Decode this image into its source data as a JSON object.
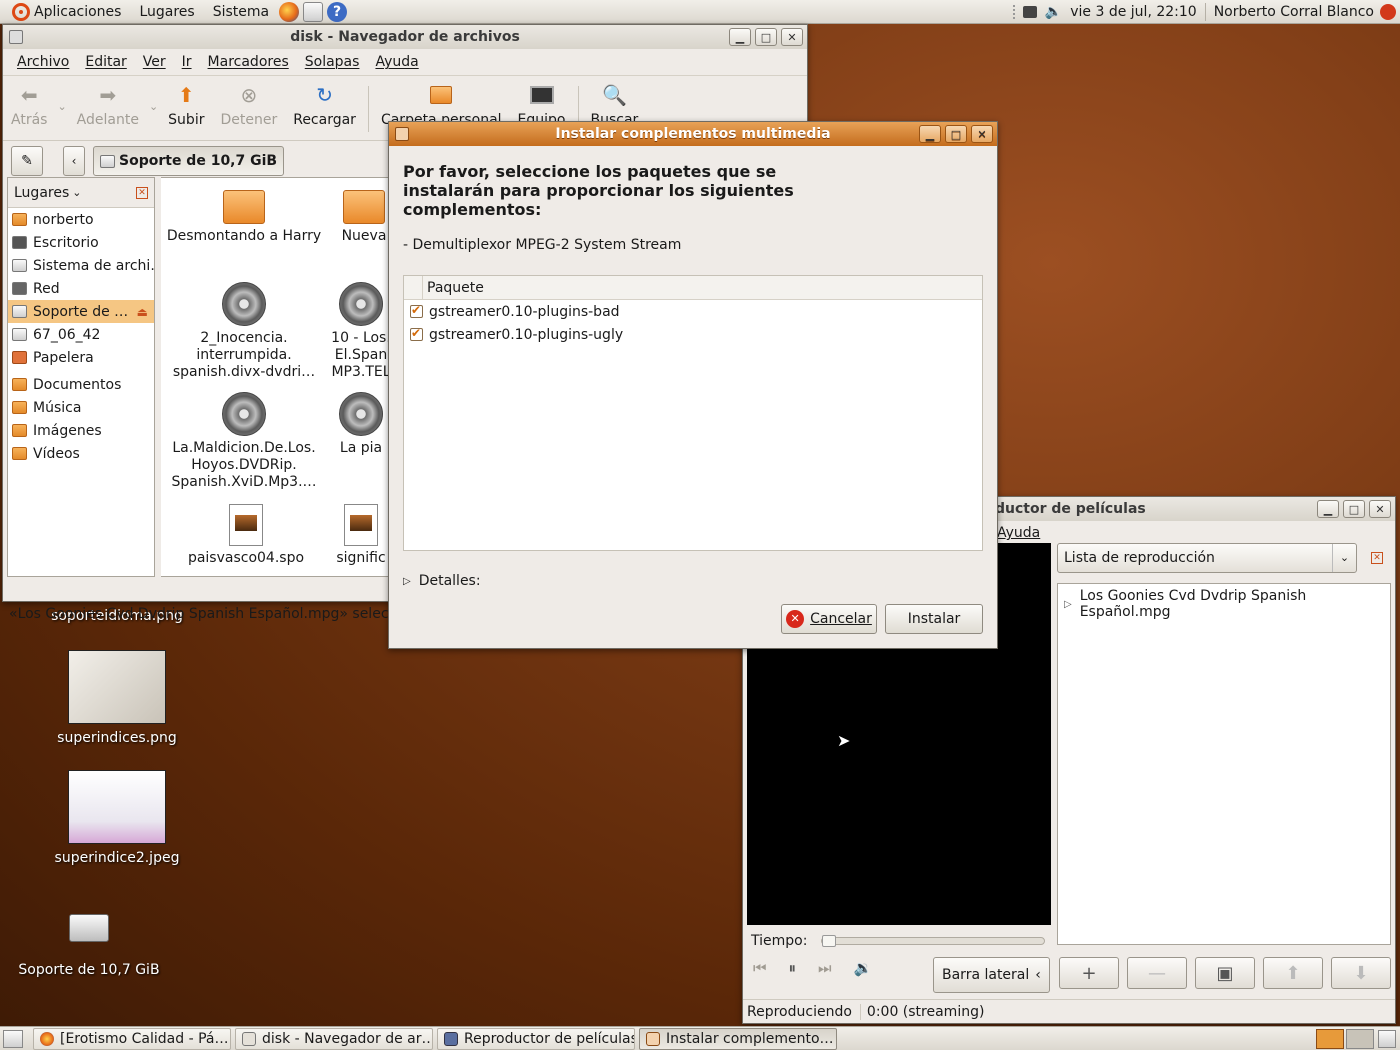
{
  "top_panel": {
    "menus": [
      "Aplicaciones",
      "Lugares",
      "Sistema"
    ],
    "clock": "vie  3 de jul, 22:10",
    "user": "Norberto Corral Blanco"
  },
  "file_manager": {
    "title": "disk - Navegador de archivos",
    "menu": [
      "Archivo",
      "Editar",
      "Ver",
      "Ir",
      "Marcadores",
      "Solapas",
      "Ayuda"
    ],
    "toolbar": {
      "back": "Atrás",
      "forward": "Adelante",
      "up": "Subir",
      "stop": "Detener",
      "reload": "Recargar",
      "home": "Carpeta personal",
      "computer": "Equipo",
      "search": "Buscar"
    },
    "location": "Soporte de 10,7 GiB",
    "sidebar_title": "Lugares",
    "places": [
      "norberto",
      "Escritorio",
      "Sistema de archi…",
      "Red",
      "Soporte de …",
      "67_06_42",
      "Papelera"
    ],
    "bookmarks": [
      "Documentos",
      "Música",
      "Imágenes",
      "Vídeos"
    ],
    "files": [
      {
        "name": "Desmontando a Harry",
        "kind": "folder"
      },
      {
        "name": "Nueva",
        "kind": "folder"
      },
      {
        "name": "2_Inocencia. interrumpida. spanish.divx-dvdri…",
        "kind": "video"
      },
      {
        "name": "10 - Los. El.Span MP3.TEL",
        "kind": "video"
      },
      {
        "name": "La.Maldicion.De.Los. Hoyos.DVDRip. Spanish.XviD.Mp3.…",
        "kind": "video"
      },
      {
        "name": "La pia",
        "kind": "video"
      },
      {
        "name": "paisvasco04.spo",
        "kind": "doc"
      },
      {
        "name": "signific",
        "kind": "doc"
      }
    ],
    "status": "«Los Goonies Cvd Dvdrip Spanish Español.mpg» selecciona"
  },
  "dialog": {
    "title": "Instalar complementos multimedia",
    "heading": "Por favor, seleccione los paquetes que se instalarán para proporcionar los siguientes complementos:",
    "plugin": "- Demultiplexor MPEG-2 System Stream",
    "column": "Paquete",
    "packages": [
      "gstreamer0.10-plugins-bad",
      "gstreamer0.10-plugins-ugly"
    ],
    "details": "Detalles:",
    "cancel": "Cancelar",
    "install": "Instalar"
  },
  "player": {
    "title": "ductor de películas",
    "menu": "Ayuda",
    "sidebar_combo": "Lista de reproducción",
    "playlist_item": "Los Goonies Cvd Dvdrip Spanish Español.mpg",
    "time_label": "Tiempo:",
    "sidebar_button": "Barra lateral",
    "status_left": "Reproduciendo",
    "status_right": "0:00 (streaming)"
  },
  "desktop": {
    "icons": [
      "soporteidioma.png",
      "superindices.png",
      "superindice2.jpeg",
      "Soporte de 10,7 GiB"
    ]
  },
  "taskbar": [
    "[Erotismo Calidad - Pá…",
    "disk - Navegador de ar…",
    "Reproductor de películas",
    "Instalar complemento…"
  ],
  "colors": {
    "accent": "#dd4814",
    "selection": "#f5c683",
    "title_active": "#c46c1d"
  }
}
